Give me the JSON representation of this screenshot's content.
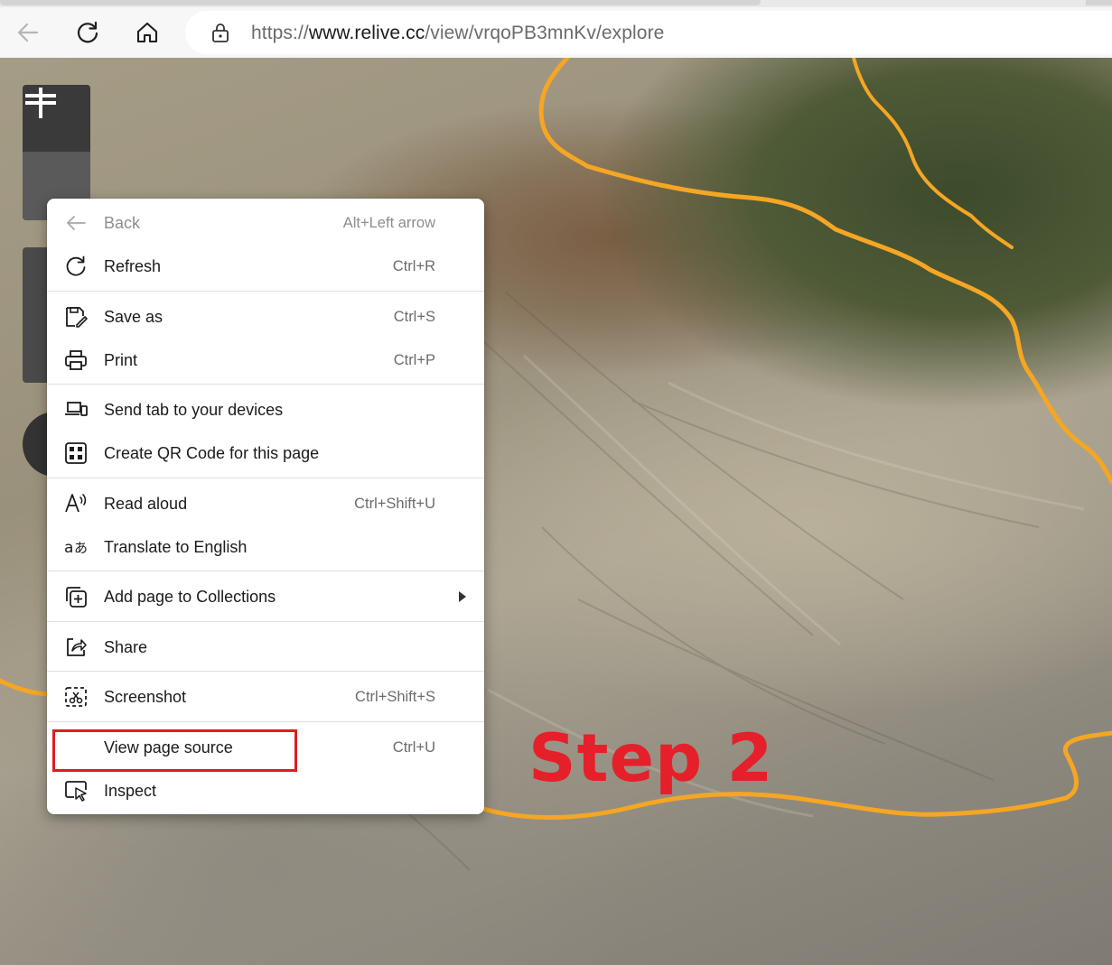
{
  "browser": {
    "url_prefix": "https://",
    "url_domain": "www.relive.cc",
    "url_path": "/view/vrqoPB3mnKv/explore",
    "nav_icons": [
      "back-icon",
      "refresh-icon",
      "home-icon",
      "lock-icon"
    ]
  },
  "map": {
    "controls": [
      "zoom-in-icon",
      "zoom-out-icon"
    ],
    "route_color": "#f5a623"
  },
  "annotation": {
    "step_label": "Step 2",
    "color": "#e5202a"
  },
  "context_menu": {
    "items": [
      {
        "label": "Back",
        "shortcut": "Alt+Left arrow",
        "icon": "back-arrow-icon",
        "disabled": true
      },
      {
        "label": "Refresh",
        "shortcut": "Ctrl+R",
        "icon": "refresh-icon"
      },
      {
        "label": "Save as",
        "shortcut": "Ctrl+S",
        "icon": "save-as-icon"
      },
      {
        "label": "Print",
        "shortcut": "Ctrl+P",
        "icon": "printer-icon"
      },
      {
        "label": "Send tab to your devices",
        "shortcut": "",
        "icon": "devices-icon"
      },
      {
        "label": "Create QR Code for this page",
        "shortcut": "",
        "icon": "qr-code-icon"
      },
      {
        "label": "Read aloud",
        "shortcut": "Ctrl+Shift+U",
        "icon": "read-aloud-icon"
      },
      {
        "label": "Translate to English",
        "shortcut": "",
        "icon": "translate-icon"
      },
      {
        "label": "Add page to Collections",
        "shortcut": "",
        "icon": "collections-icon",
        "submenu": true
      },
      {
        "label": "Share",
        "shortcut": "",
        "icon": "share-icon"
      },
      {
        "label": "Screenshot",
        "shortcut": "Ctrl+Shift+S",
        "icon": "screenshot-icon"
      },
      {
        "label": "View page source",
        "shortcut": "Ctrl+U",
        "icon": "",
        "highlighted": true
      },
      {
        "label": "Inspect",
        "shortcut": "",
        "icon": "inspect-icon"
      }
    ]
  }
}
